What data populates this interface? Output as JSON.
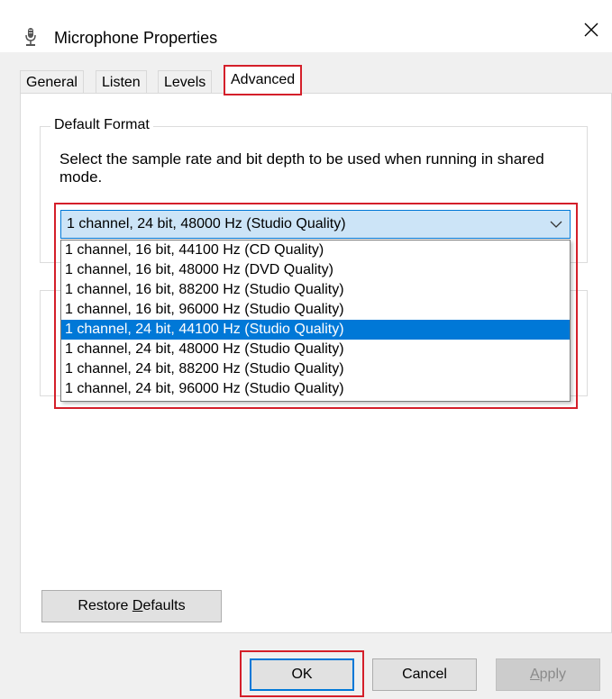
{
  "window": {
    "title": "Microphone Properties",
    "close_symbol": "✕",
    "icon": "microphone-icon"
  },
  "tabs": [
    {
      "label": "General"
    },
    {
      "label": "Listen"
    },
    {
      "label": "Levels"
    },
    {
      "label": "Advanced",
      "active": true
    }
  ],
  "default_format": {
    "group_label": "Default Format",
    "description": "Select the sample rate and bit depth to be used when running in shared mode.",
    "selected_value": "1 channel, 24 bit, 48000 Hz (Studio Quality)",
    "options": [
      "1 channel, 16 bit, 44100 Hz (CD Quality)",
      "1 channel, 16 bit, 48000 Hz (DVD Quality)",
      "1 channel, 16 bit, 88200 Hz (Studio Quality)",
      "1 channel, 16 bit, 96000 Hz (Studio Quality)",
      "1 channel, 24 bit, 44100 Hz (Studio Quality)",
      "1 channel, 24 bit, 48000 Hz (Studio Quality)",
      "1 channel, 24 bit, 88200 Hz (Studio Quality)",
      "1 channel, 24 bit, 96000 Hz (Studio Quality)"
    ],
    "highlighted_option": "1 channel, 24 bit, 44100 Hz (Studio Quality)"
  },
  "buttons": {
    "restore_defaults_pre": "Restore ",
    "restore_defaults_key": "D",
    "restore_defaults_post": "efaults",
    "ok": "OK",
    "cancel": "Cancel",
    "apply_key": "A",
    "apply_post": "pply"
  },
  "colors": {
    "accent": "#0078d7",
    "annotation_red": "#d41f2a",
    "combo_bg": "#cce4f7"
  }
}
